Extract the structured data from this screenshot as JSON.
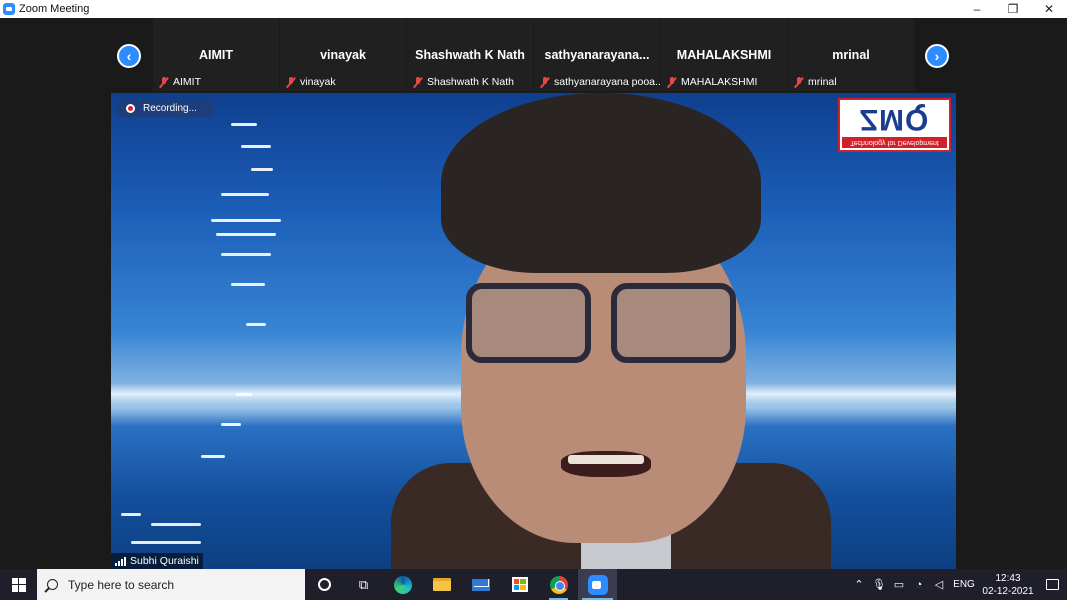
{
  "window": {
    "title": "Zoom Meeting",
    "icon": "zoom-app-icon",
    "minimize": "–",
    "restore": "❐",
    "close": "✕"
  },
  "participants": [
    {
      "name": "AIMIT",
      "label": "AIMIT"
    },
    {
      "name": "vinayak",
      "label": "vinayak"
    },
    {
      "name": "Shashwath K Nath",
      "label": "Shashwath K Nath"
    },
    {
      "name": "sathyanarayana...",
      "label": "sathyanarayana pooa..."
    },
    {
      "name": "MAHALAKSHMI",
      "label": "MAHALAKSHMI"
    },
    {
      "name": "mrinal",
      "label": "mrinal"
    }
  ],
  "nav": {
    "prev": "‹",
    "next": "›"
  },
  "video": {
    "recording_label": "Recording...",
    "speaker_name": "Subhi Quraishi",
    "logo_text": "ZMQ",
    "logo_tagline": "Technology for Development"
  },
  "taskbar": {
    "search_placeholder": "Type here to search",
    "language": "ENG",
    "time": "12:43",
    "date": "02-12-2021",
    "tray_chevron": "⌃"
  },
  "colors": {
    "accent": "#2d8cff",
    "mute": "#e54848",
    "logo_red": "#d0202a",
    "logo_blue": "#1a3d8f"
  }
}
